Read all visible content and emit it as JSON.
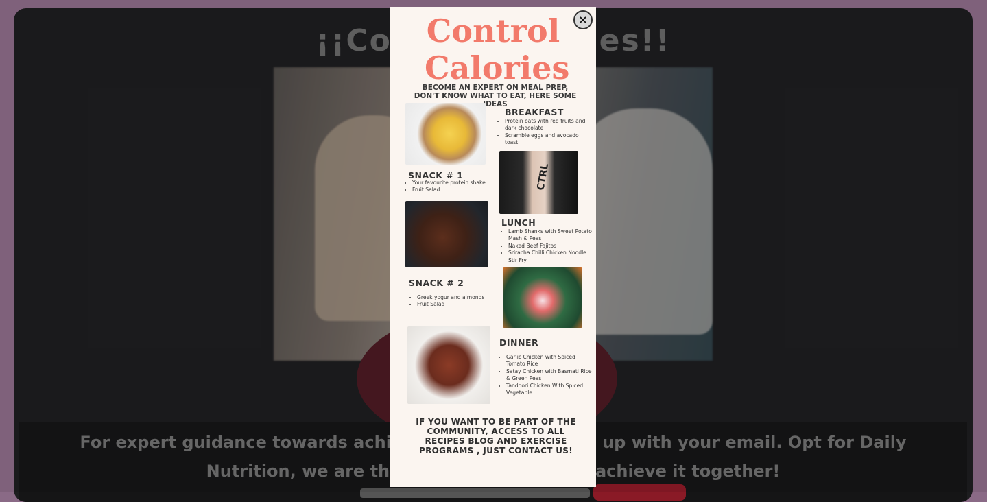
{
  "page": {
    "title": "¡¡Control Calories!!",
    "info_text": "For expert guidance towards achieving your goals, sign up with your email. Opt for Daily Nutrition, we are the smart choice, let us achieve it together!"
  },
  "modal": {
    "close_label": "×",
    "title": "Control Calories",
    "subtitle": "Become an expert on meal prep, don't know what to eat, here some ideas",
    "breakfast": {
      "heading": "BREAKFAST",
      "items": [
        "Protein oats with red fruits and dark chocolate",
        "Scramble eggs and avocado toast"
      ]
    },
    "snack1": {
      "heading": "SNACK # 1",
      "items": [
        "Your favourite protein shake",
        "Fruit Salad"
      ]
    },
    "lunch": {
      "heading": "LUNCH",
      "items": [
        "Lamb Shanks with Sweet Potato Mash & Peas",
        "Naked Beef Fajitos",
        "Sriracha Chilli Chicken Noodle Stir Fry"
      ]
    },
    "snack2": {
      "heading": "SNACK # 2",
      "items": [
        "Greek yogur and almonds",
        "Fruit Salad"
      ]
    },
    "dinner": {
      "heading": "DINNER",
      "items": [
        "Garlic Chicken with Spiced Tomato Rice",
        "Satay Chicken with Basmati Rice & Green Peas",
        "Tandoori Chicken With Spiced Vegetable"
      ]
    },
    "footer": "If you want to be part of the community, access to all recipes blog and exercise programs , just contact us!",
    "shake_logo": "CTRL"
  },
  "colors": {
    "title": "#f27a6b",
    "poster_bg": "#fbf5f0",
    "backdrop": "#8a6a86"
  }
}
